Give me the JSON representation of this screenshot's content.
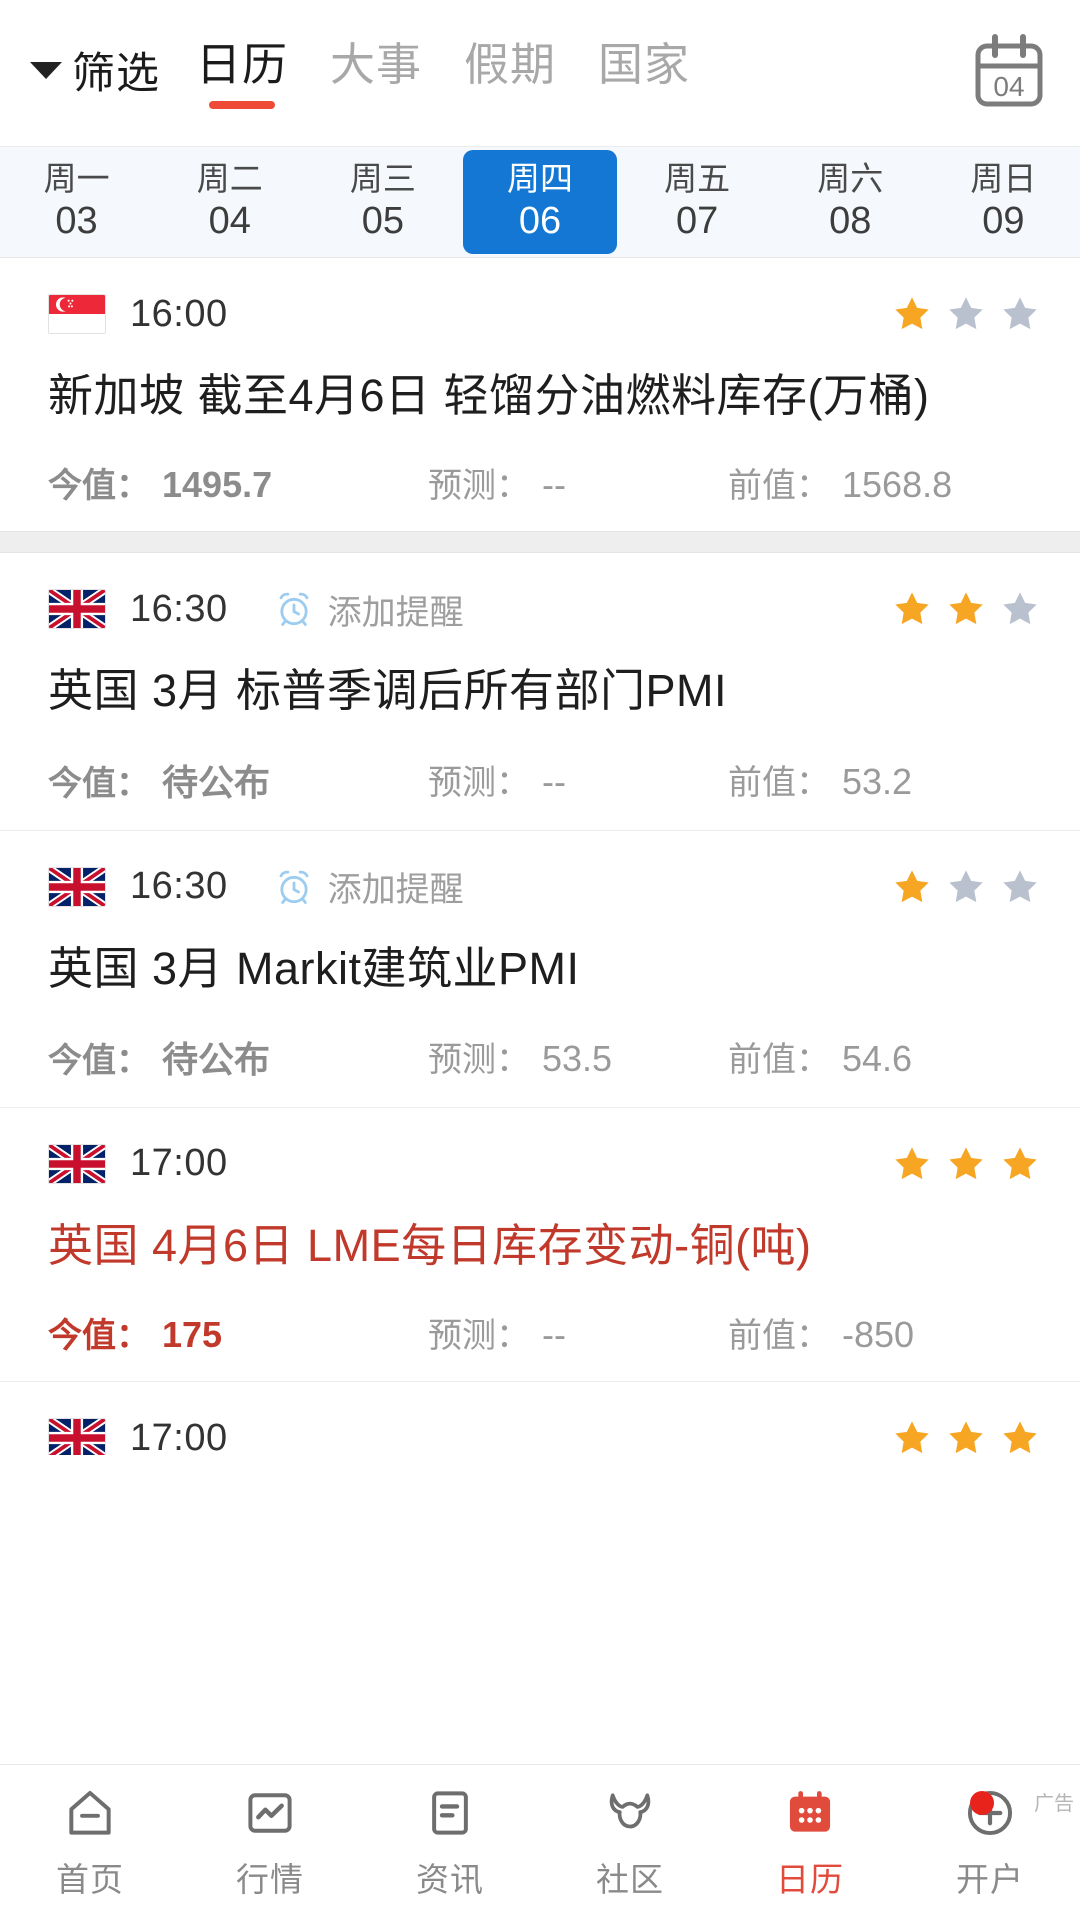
{
  "header": {
    "filter_label": "筛选",
    "filter_icon": "chevron-down-icon",
    "calendar_icon_label": "04",
    "tabs": [
      {
        "label": "日历",
        "active": true
      },
      {
        "label": "大事",
        "active": false
      },
      {
        "label": "假期",
        "active": false
      },
      {
        "label": "国家",
        "active": false
      }
    ],
    "accent_color": "#ef4a37"
  },
  "date_strip": {
    "selected_index": 3,
    "selected_color": "#1477d4",
    "days": [
      {
        "dow": "周一",
        "num": "03"
      },
      {
        "dow": "周二",
        "num": "04"
      },
      {
        "dow": "周三",
        "num": "05"
      },
      {
        "dow": "周四",
        "num": "06"
      },
      {
        "dow": "周五",
        "num": "07"
      },
      {
        "dow": "周六",
        "num": "08"
      },
      {
        "dow": "周日",
        "num": "09"
      }
    ]
  },
  "labels": {
    "actual": "今值：",
    "forecast": "预测：",
    "previous": "前值：",
    "remind": "添加提醒"
  },
  "events": [
    {
      "flag": "singapore-flag",
      "time": "16:00",
      "stars_filled": 1,
      "stars_total": 3,
      "has_remind": false,
      "title": "新加坡 截至4月6日 轻馏分油燃料库存(万桶)",
      "actual": "1495.7",
      "forecast": "--",
      "previous": "1568.8",
      "highlight": false
    },
    {
      "flag": "uk-flag",
      "time": "16:30",
      "stars_filled": 2,
      "stars_total": 3,
      "has_remind": true,
      "title": "英国 3月 标普季调后所有部门PMI",
      "actual": "待公布",
      "forecast": "--",
      "previous": "53.2",
      "highlight": false
    },
    {
      "flag": "uk-flag",
      "time": "16:30",
      "stars_filled": 1,
      "stars_total": 3,
      "has_remind": true,
      "title": "英国 3月 Markit建筑业PMI",
      "actual": "待公布",
      "forecast": "53.5",
      "previous": "54.6",
      "highlight": false
    },
    {
      "flag": "uk-flag",
      "time": "17:00",
      "stars_filled": 3,
      "stars_total": 3,
      "has_remind": false,
      "title": "英国 4月6日 LME每日库存变动-铜(吨)",
      "actual": "175",
      "forecast": "--",
      "previous": "-850",
      "highlight": true,
      "highlight_color": "#c0392b"
    },
    {
      "flag": "uk-flag",
      "time": "17:00",
      "stars_filled": 3,
      "stars_total": 3,
      "has_remind": false,
      "title": "",
      "actual": "",
      "forecast": "",
      "previous": "",
      "highlight": false,
      "clipped": true
    }
  ],
  "bottom_nav": {
    "items": [
      {
        "label": "首页",
        "icon": "home-icon",
        "active": false
      },
      {
        "label": "行情",
        "icon": "chart-square-icon",
        "active": false
      },
      {
        "label": "资讯",
        "icon": "news-document-icon",
        "active": false
      },
      {
        "label": "社区",
        "icon": "bull-head-icon",
        "active": false
      },
      {
        "label": "日历",
        "icon": "calendar-icon",
        "active": true
      },
      {
        "label": "开户",
        "icon": "plus-circle-icon",
        "active": false,
        "badge": true,
        "ad_tag": "广告"
      }
    ],
    "active_color": "#e14b3c"
  }
}
